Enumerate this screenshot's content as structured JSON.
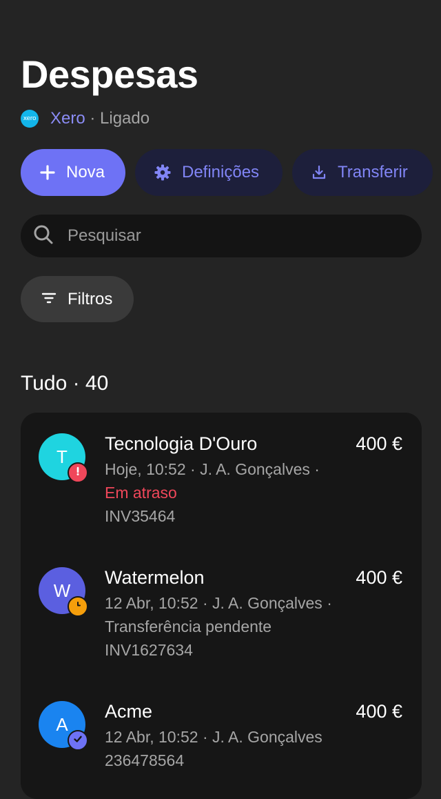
{
  "header": {
    "title": "Despesas",
    "integration": {
      "logo_text": "xero",
      "name": "Xero",
      "separator": " · ",
      "status": "Ligado"
    }
  },
  "actions": {
    "new_label": "Nova",
    "settings_label": "Definições",
    "download_label": "Transferir"
  },
  "search": {
    "placeholder": "Pesquisar"
  },
  "filters": {
    "label": "Filtros"
  },
  "section": {
    "title": "Tudo · 40"
  },
  "colors": {
    "background": "#242424",
    "accent": "#6e72f5",
    "alert": "#f0475a",
    "pending": "#f59e0b",
    "paid": "#6e72f5"
  },
  "expenses": [
    {
      "initial": "T",
      "avatar_color": "#1fd4e0",
      "status_icon": "exclamation-icon",
      "status_color": "#f0475a",
      "name": "Tecnologia D'Ouro",
      "amount": "400 €",
      "meta": "Hoje, 10:52 · J. A. Gonçalves ·",
      "status_text": "Em atraso",
      "reference": "INV35464"
    },
    {
      "initial": "W",
      "avatar_color": "#5b5fe0",
      "status_icon": "clock-icon",
      "status_color": "#f59e0b",
      "name": "Watermelon",
      "amount": "400 €",
      "meta": "12 Abr, 10:52 · J. A. Gonçalves ·",
      "status_text": "Transferência pendente",
      "reference": "INV1627634"
    },
    {
      "initial": "A",
      "avatar_color": "#1a84f0",
      "status_icon": "check-icon",
      "status_color": "#6e72f5",
      "name": "Acme",
      "amount": "400 €",
      "meta": "12 Abr, 10:52 · J. A. Gonçalves",
      "reference": "236478564"
    }
  ]
}
